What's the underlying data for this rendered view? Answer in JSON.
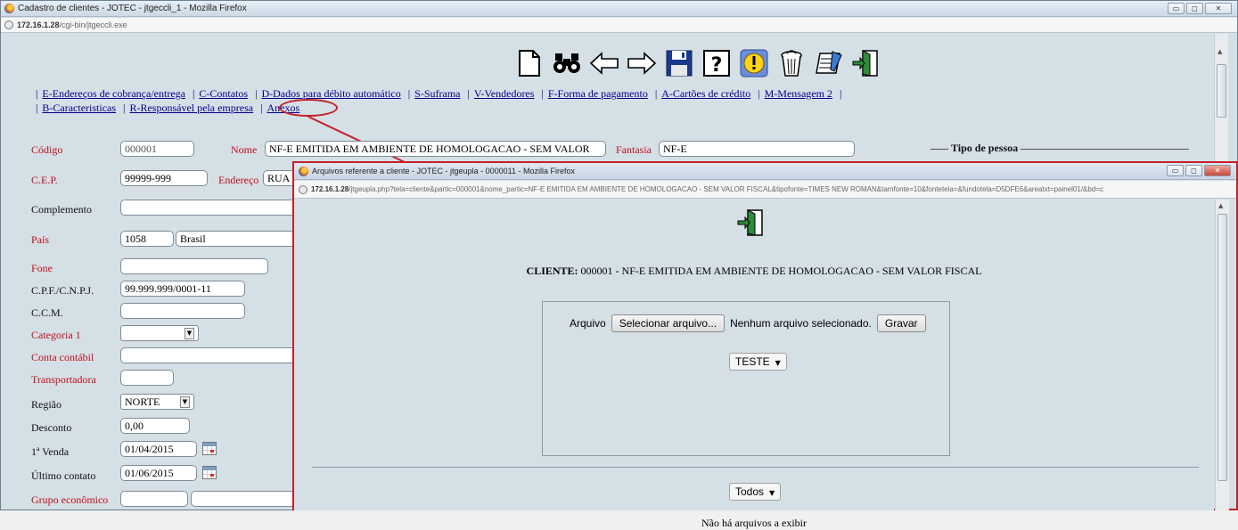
{
  "main_window": {
    "title": "Cadastro de clientes - JOTEC - jtgeccli_1 - Mozilla Firefox",
    "url_host": "172.16.1.28",
    "url_path": "/cgi-bin/jtgeccli.exe",
    "window_buttons": {
      "minimize": "▭",
      "maximize": "◻",
      "close": "✕"
    }
  },
  "toolbar": {
    "icons": [
      "new-document-icon",
      "binoculars-search-icon",
      "arrow-left-icon",
      "arrow-right-icon",
      "save-disk-icon",
      "help-question-icon",
      "alert-icon",
      "trash-icon",
      "edit-note-icon",
      "exit-door-icon"
    ]
  },
  "nav": {
    "row1": [
      "E-Endereços de cobrança/entrega",
      "C-Contatos",
      "D-Dados para débito automático",
      "S-Suframa",
      "V-Vendedores",
      "F-Forma de pagamento",
      "A-Cartões de crédito",
      "M-Mensagem 2"
    ],
    "row2": [
      "B-Caracteristicas",
      "R-Responsável pela empresa",
      "Anexos"
    ],
    "separator": "|"
  },
  "form": {
    "codigo_label": "Código",
    "codigo_value": "000001",
    "nome_label": "Nome",
    "nome_value": "NF-E EMITIDA EM AMBIENTE DE HOMOLOGACAO - SEM VALOR",
    "fantasia_label": "Fantasia",
    "fantasia_value": "NF-E",
    "tipo_pessoa_label": "Tipo de pessoa",
    "cep_label": "C.E.P.",
    "cep_value": "99999-999",
    "endereco_label": "Endereço",
    "endereco_value": "RUA",
    "complemento_label": "Complemento",
    "pais_label": "País",
    "pais_code": "1058",
    "pais_name": "Brasil",
    "fone_label": "Fone",
    "cpf_label": "C.P.F./C.N.P.J.",
    "cpf_value": "99.999.999/0001-11",
    "ccm_label": "C.C.M.",
    "categoria_label": "Categoria 1",
    "conta_label": "Conta contábil",
    "transportadora_label": "Transportadora",
    "regiao_label": "Região",
    "regiao_value": "NORTE",
    "desconto_label": "Desconto",
    "desconto_value": "0,00",
    "primeira_venda_label": "1ª Venda",
    "primeira_venda_value": "01/04/2015",
    "ultimo_contato_label": "Último contato",
    "ultimo_contato_value": "01/06/2015",
    "grupo_label": "Grupo econômico"
  },
  "popup": {
    "title": "Arquivos referente a cliente - JOTEC - jtgeupla - 0000011 - Mozilla Firefox",
    "url_host": "172.16.1.28",
    "url_path": "/jtgeupla.php?tela=cliente&partic=000001&nome_partic=NF-E EMITIDA EM AMBIENTE DE HOMOLOGACAO - SEM VALOR FISCAL&tipofonte=TIMES NEW ROMAN&tamfonte=10&fontetela=&fundotela=D5DFE6&areatxt=painel01/&bd=c",
    "cliente_label": "CLIENTE:",
    "cliente_value": "000001 - NF-E EMITIDA EM AMBIENTE DE HOMOLOGACAO - SEM VALOR FISCAL",
    "arquivo_label": "Arquivo",
    "select_file_button": "Selecionar arquivo...",
    "no_file_text": "Nenhum arquivo selecionado.",
    "save_button": "Gravar",
    "category_dropdown": "TESTE",
    "filter_dropdown": "Todos",
    "empty_message": "Não há arquivos a exibir"
  },
  "colors": {
    "page_background": "#d5dfe6",
    "required_label": "#c0101a",
    "link": "#00008b",
    "highlight": "#c42129"
  }
}
